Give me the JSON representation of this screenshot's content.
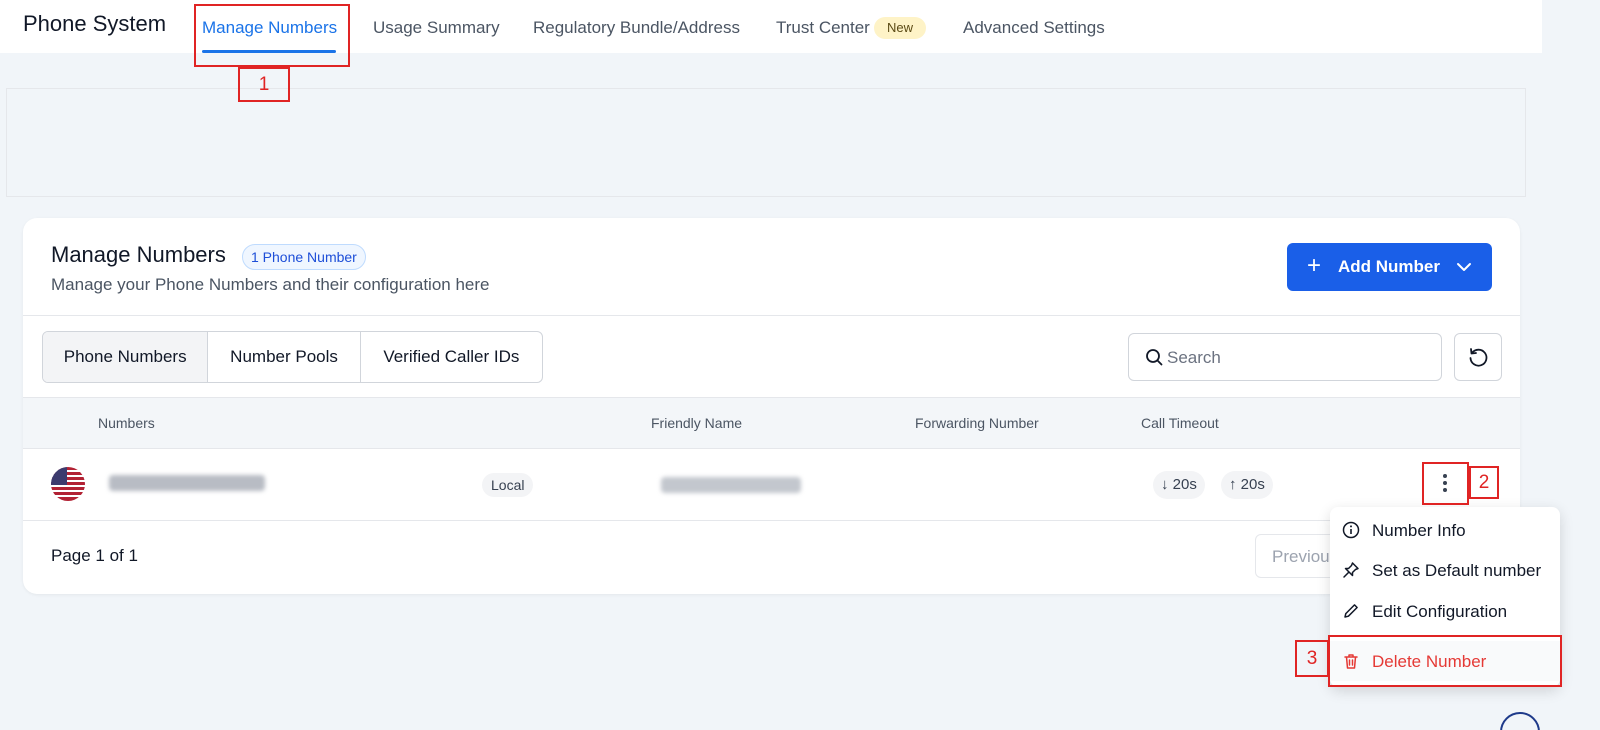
{
  "app_title": "Phone System",
  "nav": {
    "tabs": [
      "Manage Numbers",
      "Usage Summary",
      "Regulatory Bundle/Address",
      "Trust Center",
      "Advanced Settings"
    ],
    "active": "Manage Numbers",
    "new_badge": "New"
  },
  "card": {
    "title": "Manage Numbers",
    "count_badge": "1 Phone Number",
    "subtitle": "Manage your Phone Numbers and their configuration here",
    "add_button": "Add Number"
  },
  "segments": [
    "Phone Numbers",
    "Number Pools",
    "Verified Caller IDs"
  ],
  "search": {
    "placeholder": "Search"
  },
  "table": {
    "headers": [
      "Numbers",
      "Friendly Name",
      "Forwarding Number",
      "Call Timeout"
    ],
    "rows": [
      {
        "type": "Local",
        "timeout_in": "20s",
        "timeout_out": "20s"
      }
    ]
  },
  "pagination": {
    "page_text": "Page 1 of 1",
    "prev": "Previous"
  },
  "row_menu": {
    "items": [
      "Number Info",
      "Set as Default number",
      "Edit Configuration",
      "Delete Number"
    ]
  },
  "annotations": [
    "1",
    "2",
    "3"
  ],
  "colors": {
    "accent": "#1a73e8",
    "primary_button": "#1a5fe8",
    "danger": "#e53935",
    "annotation": "#e02424"
  },
  "icons": [
    "plus-icon",
    "chevron-down-icon",
    "search-icon",
    "refresh-icon",
    "kebab-icon",
    "info-icon",
    "pin-icon",
    "pencil-icon",
    "trash-icon",
    "us-flag-icon"
  ]
}
